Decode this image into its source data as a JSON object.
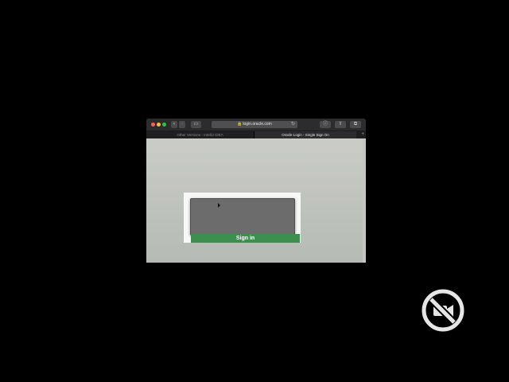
{
  "browser": {
    "address": "login.oracle.com",
    "nav_back_icon": "‹",
    "nav_forward_icon": "›",
    "reload_icon": "↻",
    "lock_icon": "🔒",
    "info_icon": "ⓘ",
    "share_icon": "⇧",
    "tabs_icon": "⧉",
    "sidebar_icon": "▭",
    "tabs": [
      {
        "label": "Other Versions - IntelliJ IDEA"
      },
      {
        "label": "Oracle Login - Single Sign On"
      }
    ],
    "new_tab_icon": "+"
  },
  "page": {
    "signin_label": "Sign in"
  },
  "colors": {
    "signin_green": "#3c8f4f",
    "page_bg": "#c9ccc7"
  },
  "overlay": {
    "icon": "camera-disabled-icon"
  }
}
